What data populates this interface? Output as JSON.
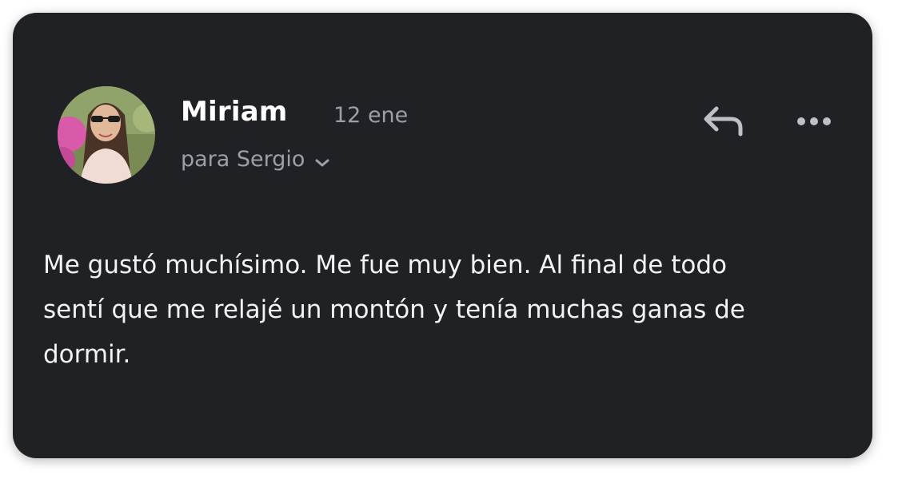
{
  "message": {
    "sender_name": "Miriam",
    "date": "12 ene",
    "recipient_line": "para Sergio",
    "body_lines": [
      "Me gustó muchísimo. Me fue muy bien. Al final de todo",
      "sentí que me relajé un montón y tenía muchas ganas de",
      "dormir."
    ]
  },
  "icons": {
    "reply": "reply-arrow-icon",
    "more": "more-horizontal-icon",
    "recipient_toggle": "chevron-down-icon",
    "avatar": "profile-photo"
  },
  "colors": {
    "card_background": "#202124",
    "primary_text": "#ffffff",
    "secondary_text": "#9aa0a6"
  }
}
